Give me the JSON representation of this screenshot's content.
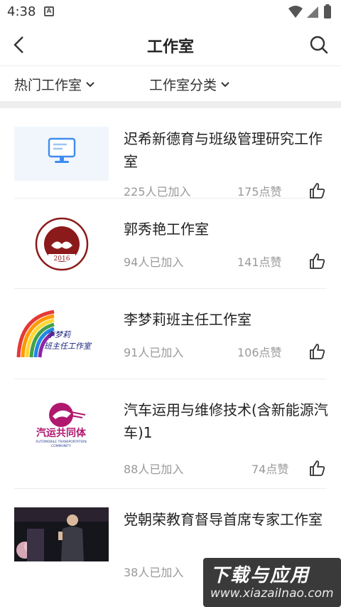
{
  "status_bar": {
    "time": "4:38",
    "notif_letter": "A"
  },
  "header": {
    "title": "工作室"
  },
  "filters": {
    "hot": "热门工作室",
    "category": "工作室分类"
  },
  "items": [
    {
      "title": "迟希新德育与班级管理研究工作室",
      "members": "225人已加入",
      "likes": "175点赞",
      "thumb": "computer-icon"
    },
    {
      "title": "郭秀艳工作室",
      "members": "94人已加入",
      "likes": "141点赞",
      "thumb": "seal-logo",
      "seal_year": "2016"
    },
    {
      "title": "李梦莉班主任工作室",
      "members": "91人已加入",
      "likes": "106点赞",
      "thumb": "rainbow-logo",
      "logo_line1": "李梦莉",
      "logo_line2": "班主任工作室"
    },
    {
      "title": "汽车运用与维修技术(含新能源汽车)1",
      "members": "88人已加入",
      "likes": "74点赞",
      "thumb": "auto-logo",
      "logo_cn": "汽运共同体",
      "logo_en1": "AUTOMOBILE TRANSPORTATION",
      "logo_en2": "COMMUNITY"
    },
    {
      "title": "党朝荣教育督导首席专家工作室",
      "members": "38人已加入",
      "likes": "",
      "thumb": "speaker-photo"
    }
  ],
  "watermark": {
    "main": "下载与应用",
    "sub": "www.xiazaiInao.com"
  },
  "colors": {
    "accent_blue": "#3f8cf0",
    "seal_red": "#8b1a1a",
    "auto_magenta": "#b0186e",
    "auto_blue": "#2a3f8f"
  }
}
